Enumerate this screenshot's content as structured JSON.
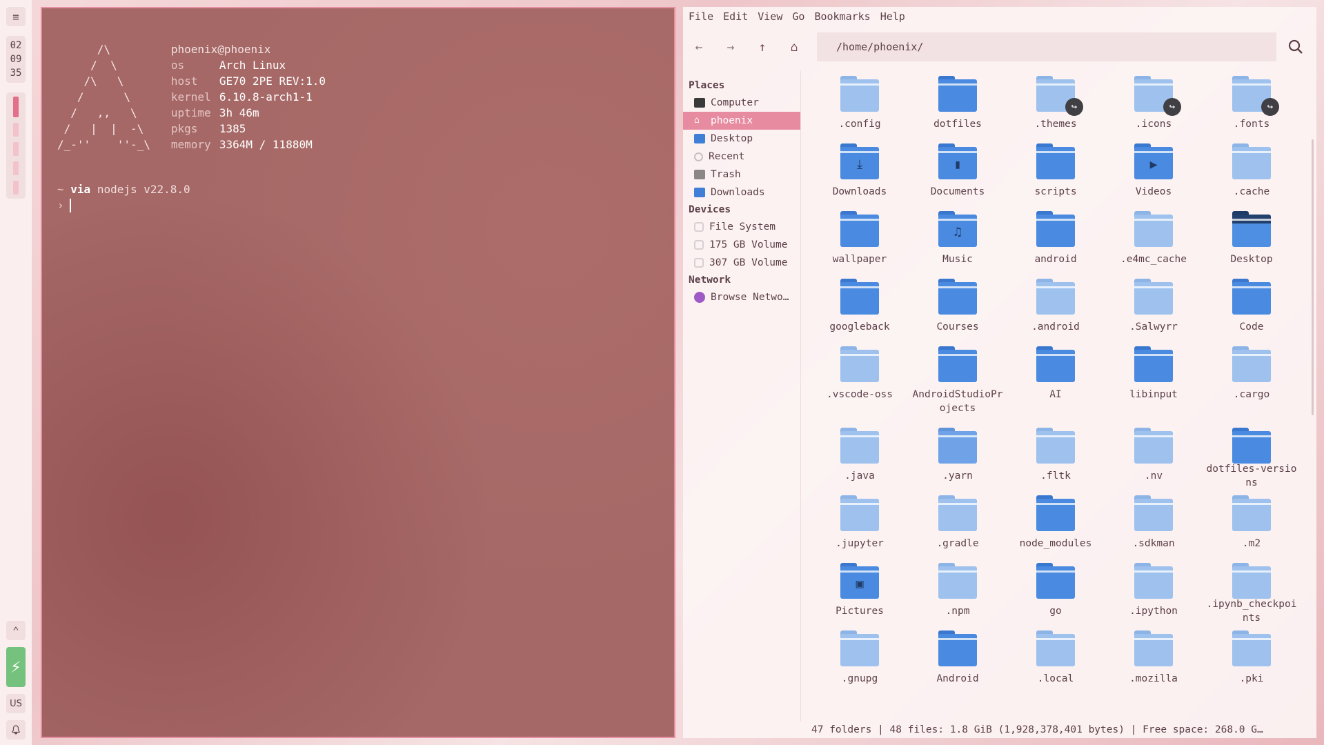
{
  "bar": {
    "menu_glyph": "≡",
    "clock": [
      "02",
      "09",
      "35"
    ],
    "up_glyph": "⌃",
    "battery_glyph": "⚡",
    "keyboard_layout": "US",
    "bell_glyph": "🔔"
  },
  "terminal": {
    "ascii_art": "      /\\\n     /  \\\n    /\\   \\\n   /      \\\n  /   ,,   \\\n /   |  |  -\\\n/_-''    ''-_\\",
    "user_host": "phoenix@phoenix",
    "info": [
      {
        "key": "os",
        "value": "Arch Linux"
      },
      {
        "key": "host",
        "value": "GE70 2PE REV:1.0"
      },
      {
        "key": "kernel",
        "value": "6.10.8-arch1-1"
      },
      {
        "key": "uptime",
        "value": "3h 46m"
      },
      {
        "key": "pkgs",
        "value": "1385"
      },
      {
        "key": "memory",
        "value": "3364M / 11880M"
      }
    ],
    "prompt_tilde": "~",
    "prompt_via": "via",
    "prompt_node": "nodejs v22.8.0",
    "prompt_symbol": "›"
  },
  "fm": {
    "menu": [
      "File",
      "Edit",
      "View",
      "Go",
      "Bookmarks",
      "Help"
    ],
    "path": "/home/phoenix/",
    "nav": {
      "back": "←",
      "forward": "→",
      "up": "↑",
      "home": "⌂"
    },
    "sections": {
      "places": "Places",
      "devices": "Devices",
      "network": "Network"
    },
    "places": [
      "Computer",
      "phoenix",
      "Desktop",
      "Recent",
      "Trash",
      "Downloads"
    ],
    "devices": [
      "File System",
      "175 GB Volume",
      "307 GB Volume"
    ],
    "network": [
      "Browse Netwo…"
    ],
    "files": [
      {
        "name": ".config",
        "color": "light",
        "glyph": "",
        "link": false
      },
      {
        "name": "dotfiles",
        "color": "dark",
        "glyph": "",
        "link": false
      },
      {
        "name": ".themes",
        "color": "light",
        "glyph": "",
        "link": true
      },
      {
        "name": ".icons",
        "color": "light",
        "glyph": "",
        "link": true
      },
      {
        "name": ".fonts",
        "color": "light",
        "glyph": "",
        "link": true
      },
      {
        "name": "Downloads",
        "color": "dark",
        "glyph": "⤓",
        "link": false
      },
      {
        "name": "Documents",
        "color": "dark",
        "glyph": "▮",
        "link": false
      },
      {
        "name": "scripts",
        "color": "dark",
        "glyph": "",
        "link": false
      },
      {
        "name": "Videos",
        "color": "dark",
        "glyph": "▶",
        "link": false
      },
      {
        "name": ".cache",
        "color": "light",
        "glyph": "",
        "link": false
      },
      {
        "name": "wallpaper",
        "color": "dark",
        "glyph": "",
        "link": false
      },
      {
        "name": "Music",
        "color": "dark",
        "glyph": "♫",
        "link": false
      },
      {
        "name": "android",
        "color": "dark",
        "glyph": "",
        "link": false
      },
      {
        "name": ".e4mc_cache",
        "color": "light",
        "glyph": "",
        "link": false
      },
      {
        "name": "Desktop",
        "color": "desk",
        "glyph": "",
        "link": false
      },
      {
        "name": "googleback",
        "color": "dark",
        "glyph": "",
        "link": false
      },
      {
        "name": "Courses",
        "color": "dark",
        "glyph": "",
        "link": false
      },
      {
        "name": ".android",
        "color": "light",
        "glyph": "",
        "link": false
      },
      {
        "name": ".Salwyrr",
        "color": "light",
        "glyph": "",
        "link": false
      },
      {
        "name": "Code",
        "color": "dark",
        "glyph": "",
        "link": false
      },
      {
        "name": ".vscode-oss",
        "color": "light",
        "glyph": "",
        "link": false
      },
      {
        "name": "AndroidStudioProjects",
        "color": "dark",
        "glyph": "",
        "link": false
      },
      {
        "name": "AI",
        "color": "dark",
        "glyph": "",
        "link": false
      },
      {
        "name": "libinput",
        "color": "dark",
        "glyph": "",
        "link": false
      },
      {
        "name": ".cargo",
        "color": "light",
        "glyph": "",
        "link": false
      },
      {
        "name": ".java",
        "color": "light",
        "glyph": "",
        "link": false
      },
      {
        "name": ".yarn",
        "color": "mid",
        "glyph": "",
        "link": false
      },
      {
        "name": ".fltk",
        "color": "light",
        "glyph": "",
        "link": false
      },
      {
        "name": ".nv",
        "color": "light",
        "glyph": "",
        "link": false
      },
      {
        "name": "dotfiles-versions",
        "color": "dark",
        "glyph": "",
        "link": false
      },
      {
        "name": ".jupyter",
        "color": "light",
        "glyph": "",
        "link": false
      },
      {
        "name": ".gradle",
        "color": "light",
        "glyph": "",
        "link": false
      },
      {
        "name": "node_modules",
        "color": "dark",
        "glyph": "",
        "link": false
      },
      {
        "name": ".sdkman",
        "color": "light",
        "glyph": "",
        "link": false
      },
      {
        "name": ".m2",
        "color": "light",
        "glyph": "",
        "link": false
      },
      {
        "name": "Pictures",
        "color": "dark",
        "glyph": "▣",
        "link": false
      },
      {
        "name": ".npm",
        "color": "light",
        "glyph": "",
        "link": false
      },
      {
        "name": "go",
        "color": "dark",
        "glyph": "",
        "link": false
      },
      {
        "name": ".ipython",
        "color": "light",
        "glyph": "",
        "link": false
      },
      {
        "name": ".ipynb_checkpoints",
        "color": "light",
        "glyph": "",
        "link": false
      },
      {
        "name": ".gnupg",
        "color": "light",
        "glyph": "",
        "link": false
      },
      {
        "name": "Android",
        "color": "dark",
        "glyph": "",
        "link": false
      },
      {
        "name": ".local",
        "color": "light",
        "glyph": "",
        "link": false
      },
      {
        "name": ".mozilla",
        "color": "light",
        "glyph": "",
        "link": false
      },
      {
        "name": ".pki",
        "color": "light",
        "glyph": "",
        "link": false
      }
    ],
    "status": "47 folders  |  48 files: 1.8 GiB (1,928,378,401 bytes)  |  Free space: 268.0 G…"
  }
}
